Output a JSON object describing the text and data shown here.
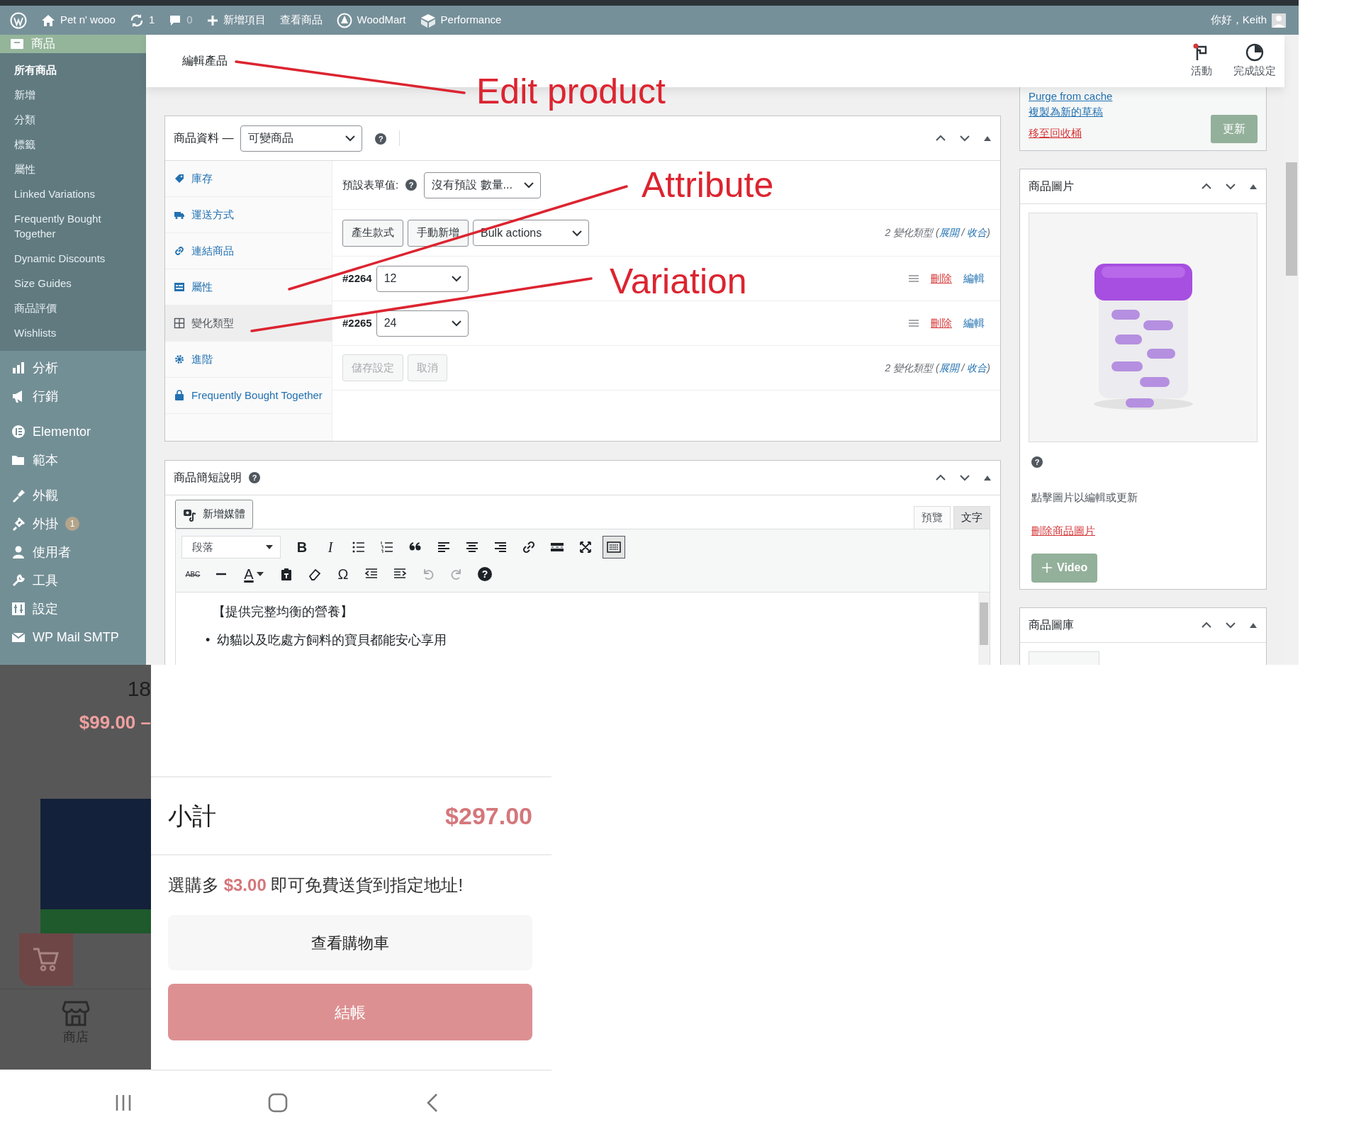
{
  "admin_bar": {
    "site": "Pet n' wooo",
    "updates": "1",
    "comments": "0",
    "new_item": "新增項目",
    "view": "查看商品",
    "theme": "WoodMart",
    "performance": "Performance",
    "greeting": "你好，Keith"
  },
  "sidebar": {
    "current": {
      "label": "商品",
      "selected": true
    },
    "submenu": [
      {
        "label": "所有商品",
        "selected": true
      },
      {
        "label": "新增",
        "selected": false
      },
      {
        "label": "分類",
        "selected": false
      },
      {
        "label": "標籤",
        "selected": false
      },
      {
        "label": "屬性",
        "selected": false
      },
      {
        "label": "Linked Variations",
        "selected": false
      },
      {
        "label": "Frequently Bought Together",
        "selected": false
      },
      {
        "label": "Dynamic Discounts",
        "selected": false
      },
      {
        "label": "Size Guides",
        "selected": false
      },
      {
        "label": "商品評價",
        "selected": false
      },
      {
        "label": "Wishlists",
        "selected": false
      }
    ],
    "menu_groups": [
      [
        {
          "label": "分析"
        },
        {
          "label": "行銷"
        }
      ],
      [
        {
          "label": "Elementor"
        },
        {
          "label": "範本"
        }
      ],
      [
        {
          "label": "外觀"
        },
        {
          "label": "外掛",
          "badge": "1"
        },
        {
          "label": "使用者"
        },
        {
          "label": "工具"
        },
        {
          "label": "設定"
        },
        {
          "label": "WP Mail SMTP"
        }
      ]
    ]
  },
  "header": {
    "title": "編輯產品",
    "actions": [
      {
        "label": "活動",
        "unread": true
      },
      {
        "label": "完成設定",
        "unread": false
      }
    ]
  },
  "product_data": {
    "label": "商品資料 —",
    "type": "可變商品",
    "help": "?",
    "tabs": [
      {
        "label": "庫存",
        "selected": false
      },
      {
        "label": "運送方式",
        "selected": false
      },
      {
        "label": "連結商品",
        "selected": false
      },
      {
        "label": "屬性",
        "selected": false
      },
      {
        "label": "變化類型",
        "selected": true
      },
      {
        "label": "進階",
        "selected": false
      },
      {
        "label": "Frequently Bought Together",
        "selected": false
      }
    ],
    "default_label": "預設表單值:",
    "default_help": "?",
    "default_value": "沒有預設 數量...",
    "actions": [
      "產生款式",
      "手動新增"
    ],
    "bulk": "Bulk actions",
    "summaries": [
      {
        "prefix": "2 變化類型 (",
        "expand": "展開",
        "separator": " / ",
        "collapse": "收合",
        "suffix": ")"
      },
      {
        "prefix": "2 變化類型 (",
        "expand": "展開",
        "separator": " / ",
        "collapse": "收合",
        "suffix": ")"
      }
    ],
    "variations": [
      {
        "id": "#2264",
        "value": "12",
        "remove": "刪除",
        "edit": "編輯"
      },
      {
        "id": "#2265",
        "value": "24",
        "remove": "刪除",
        "edit": "編輯"
      }
    ],
    "footer_buttons": [
      {
        "label": "儲存設定",
        "disabled": true
      },
      {
        "label": "取消",
        "disabled": true
      }
    ]
  },
  "short_description": {
    "title": "商品簡短說明",
    "help": "?",
    "add_media": "新增媒體",
    "modes": [
      {
        "label": "預覽",
        "selected": false
      },
      {
        "label": "文字",
        "selected": true
      }
    ],
    "format": "段落",
    "toolbar_rows": [
      [
        {
          "kind": "bold",
          "glyph": "B",
          "pressed": false
        },
        {
          "kind": "italic",
          "glyph": "I",
          "pressed": false
        },
        {
          "kind": "bullist",
          "pressed": false
        },
        {
          "kind": "numlist",
          "pressed": false
        },
        {
          "kind": "blockquote",
          "pressed": false
        },
        {
          "kind": "alignleft",
          "pressed": false
        },
        {
          "kind": "aligncenter",
          "pressed": false
        },
        {
          "kind": "alignright",
          "pressed": false
        },
        {
          "kind": "link",
          "pressed": false
        },
        {
          "kind": "more",
          "pressed": false
        },
        {
          "kind": "fullscreen",
          "pressed": false
        },
        {
          "kind": "toolbar",
          "pressed": true
        }
      ],
      [
        {
          "kind": "strike",
          "glyph": "ABC",
          "disabled": false
        },
        {
          "kind": "hr",
          "disabled": false
        },
        {
          "kind": "color",
          "glyph": "A",
          "disabled": false
        },
        {
          "kind": "paste",
          "disabled": false
        },
        {
          "kind": "eraser",
          "disabled": false
        },
        {
          "kind": "charmap",
          "glyph": "Ω",
          "disabled": false
        },
        {
          "kind": "outdent",
          "disabled": false
        },
        {
          "kind": "indent",
          "disabled": false
        },
        {
          "kind": "undo",
          "disabled": true
        },
        {
          "kind": "redo",
          "disabled": true
        },
        {
          "kind": "help",
          "glyph": "?",
          "disabled": false
        }
      ]
    ],
    "content": {
      "heading": "【提供完整均衡的營養】",
      "bullets": [
        {
          "marker": "•",
          "text": "幼貓以及吃處方飼料的寶貝都能安心享用"
        }
      ]
    }
  },
  "publish": {
    "purge": "Purge from cache",
    "duplicate": "複製為新的草稿",
    "trash": "移至回收桶",
    "update": "更新"
  },
  "product_image": {
    "title": "商品圖片",
    "help": "?",
    "hint": "點擊圖片以編輯或更新",
    "remove": "刪除商品圖片",
    "video": "Video"
  },
  "gallery": {
    "title": "商品圖庫"
  },
  "annotations": [
    {
      "text": "Edit product"
    },
    {
      "text": "Attribute"
    },
    {
      "text": "Variation"
    }
  ],
  "phone": {
    "background": {
      "count": "18",
      "price": "$99.00 –",
      "nav_label": "商店"
    },
    "cart": {
      "subtotal_label": "小計",
      "subtotal": "$297.00",
      "shipping": {
        "prefix": "選購多 ",
        "amount": "$3.00",
        "suffix": " 即可免費送貨到指定地址!"
      },
      "view_cart": "查看購物車",
      "checkout": "結帳"
    }
  }
}
